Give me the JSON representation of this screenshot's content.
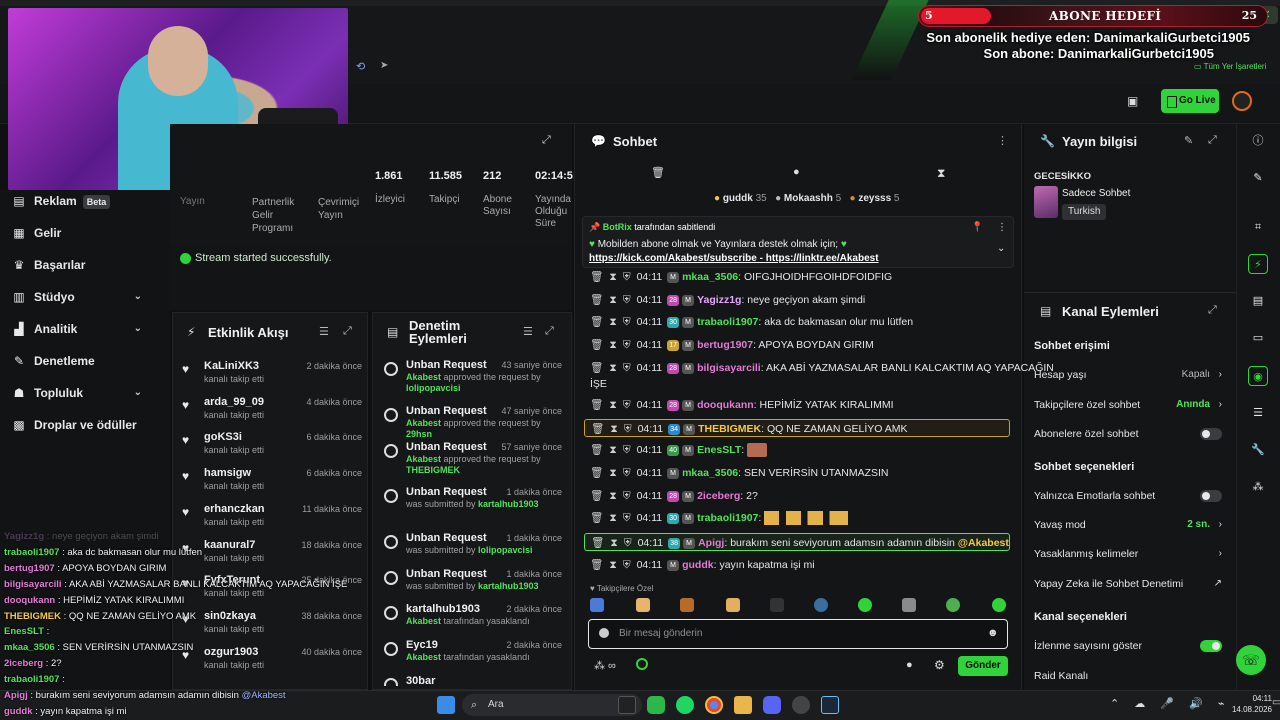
{
  "overlay": {
    "subgoal_current": "5",
    "subgoal_label": "ABONE HEDEFİ",
    "subgoal_target": "25",
    "gift_line": "Son abonelik hediye eden: DanimarkaliGurbetci1905",
    "last_sub_line": "Son abone: DanimarkaliGurbetci1905",
    "bookmarks": "Tüm Yer İşaretleri"
  },
  "header": {
    "go_live": "Go Live"
  },
  "sidebar": {
    "items": [
      {
        "label": "Reklam",
        "badge": "Beta"
      },
      {
        "label": "Gelir"
      },
      {
        "label": "Başarılar"
      },
      {
        "label": "Stüdyo"
      },
      {
        "label": "Analitik"
      },
      {
        "label": "Denetleme"
      },
      {
        "label": "Topluluk"
      },
      {
        "label": "Droplar ve ödüller"
      }
    ]
  },
  "stats": {
    "partial": {
      "label1": "Yayın",
      "label2": "Partnerlik Gelir Programı",
      "label3": "Çevrimiçi Yayın"
    },
    "viewers": {
      "value": "1.861",
      "label": "İzleyici"
    },
    "followers": {
      "value": "11.585",
      "label": "Takipçi"
    },
    "subs": {
      "value": "212",
      "label": "Abone Sayısı"
    },
    "uptime": {
      "value": "02:14:5:",
      "label": "Yayında Olduğu Süre"
    }
  },
  "toast": "Stream started successfully.",
  "activity": {
    "title": "Etkinlik Akışı",
    "items": [
      {
        "name": "KaLiniXK3",
        "sub": "kanalı takip etti",
        "time": "2 dakika önce"
      },
      {
        "name": "arda_99_09",
        "sub": "kanalı takip etti",
        "time": "4 dakika önce"
      },
      {
        "name": "goKS3i",
        "sub": "kanalı takip etti",
        "time": "6 dakika önce"
      },
      {
        "name": "hamsigw",
        "sub": "kanalı takip etti",
        "time": "6 dakika önce"
      },
      {
        "name": "erhanczkan",
        "sub": "kanalı takip etti",
        "time": "11 dakika önce"
      },
      {
        "name": "kaanural7",
        "sub": "kanalı takip etti",
        "time": "18 dakika önce"
      },
      {
        "name": "FyfxTerunt",
        "sub": "kanalı takip etti",
        "time": "25 dakika önce"
      },
      {
        "name": "sin0zkaya",
        "sub": "kanalı takip etti",
        "time": "38 dakika önce"
      },
      {
        "name": "ozgur1903",
        "sub": "kanalı takip etti",
        "time": "40 dakika önce"
      }
    ]
  },
  "moderation": {
    "title": "Denetim Eylemleri",
    "items": [
      {
        "name": "Unban Request",
        "who": "Akabest",
        "sub": " approved the request by ",
        "target": "lolipopavcisi",
        "time": "43 saniye önce"
      },
      {
        "name": "Unban Request",
        "who": "Akabest",
        "sub": " approved the request by ",
        "target": "29hsn",
        "time": "47 saniye önce"
      },
      {
        "name": "Unban Request",
        "who": "Akabest",
        "sub": " approved the request by ",
        "target": "THEBIGMEK",
        "time": "57 saniye önce"
      },
      {
        "name": "Unban Request",
        "who": "",
        "sub": "was submitted by ",
        "target": "kartalhub1903",
        "time": "1 dakika önce"
      },
      {
        "name": "Unban Request",
        "who": "",
        "sub": "was submitted by ",
        "target": "lolipopavcisi",
        "time": "1 dakika önce"
      },
      {
        "name": "Unban Request",
        "who": "",
        "sub": "was submitted by ",
        "target": "kartalhub1903",
        "time": "1 dakika önce"
      },
      {
        "name": "kartalhub1903",
        "who": "Akabest",
        "sub": " tarafından yasaklandı",
        "target": "",
        "time": "2 dakika önce"
      },
      {
        "name": "Eyc19",
        "who": "Akabest",
        "sub": " tarafından yasaklandı",
        "target": "",
        "time": "2 dakika önce"
      },
      {
        "name": "30bar",
        "who": "",
        "sub": "",
        "target": "",
        "time": ""
      }
    ]
  },
  "chat": {
    "title": "Sohbet",
    "top_gifters": [
      {
        "name": "guddk",
        "count": "35"
      },
      {
        "name": "Mokaashh",
        "count": "5"
      },
      {
        "name": "zeysss",
        "count": "5"
      }
    ],
    "pinned": {
      "by": "BotRix",
      "by_suffix": "tarafından sabitlendi",
      "text": "Mobilden abone olmak ve Yayınlara destek olmak için;",
      "link1": "https://kick.com/Akabest/subscribe",
      "sep": " - ",
      "link2": "https://linktr.ee/Akabest"
    },
    "messages": [
      {
        "time": "04:11",
        "badge": "",
        "user": "mkaa_3506",
        "color": "#53e05c",
        "text": "OIFGJHOIDHFGOIHDFOIDFIG"
      },
      {
        "time": "04:11",
        "badge": "28",
        "user": "Yagizz1g",
        "color": "#e6a6ff",
        "text": "neye geçiyon akam şimdi"
      },
      {
        "time": "04:11",
        "badge": "30",
        "user": "trabaoli1907",
        "color": "#53e05c",
        "text": "aka dc bakmasan olur mu lütfen"
      },
      {
        "time": "04:11",
        "badge": "17",
        "user": "bertug1907",
        "color": "#e37bd6",
        "text": "APOYA BOYDAN GIRIM"
      },
      {
        "time": "04:11",
        "badge": "28",
        "user": "bilgisayarcili",
        "color": "#e37bd6",
        "text": "AKA ABİ YAZMASALAR BANLI KALCAKTIM AQ YAPACAĞIN"
      },
      {
        "time": "",
        "badge": "",
        "user": "",
        "color": "#e6e6e6",
        "text": "İŞE"
      },
      {
        "time": "04:11",
        "badge": "28",
        "user": "dooqukann",
        "color": "#e37bd6",
        "text": "HEPİMİZ YATAK KIRALIMMI"
      },
      {
        "time": "04:11",
        "badge": "34",
        "user": "THEBIGMEK",
        "color": "#f2c94c",
        "text": "QQ NE ZAMAN GELİYO AMK"
      },
      {
        "time": "04:11",
        "badge": "40",
        "user": "EnesSLT",
        "color": "#53e05c",
        "text": ""
      },
      {
        "time": "04:11",
        "badge": "",
        "user": "mkaa_3506",
        "color": "#53e05c",
        "text": "SEN VERİRSİN UTANMAZSIN"
      },
      {
        "time": "04:11",
        "badge": "28",
        "user": "2iceberg",
        "color": "#e37bd6",
        "text": "2?"
      },
      {
        "time": "04:11",
        "badge": "30",
        "user": "trabaoli1907",
        "color": "#53e05c",
        "text": ""
      },
      {
        "time": "04:11",
        "badge": "38",
        "user": "Apigj",
        "color": "#e37bd6",
        "text": "burakım seni seviyorum adamsın adamın dibisin ",
        "mention": "@Akabest"
      },
      {
        "time": "04:11",
        "badge": "",
        "user": "guddk",
        "color": "#e37bd6",
        "text": "yayın kapatma işi mi"
      }
    ],
    "emote_label": "Takipçilere Özel",
    "input_placeholder": "Bir mesaj gönderin",
    "send": "Gönder"
  },
  "stream_info": {
    "title": "Yayın bilgisi",
    "category": "GECESİKKO",
    "stream_title": "Sadece Sohbet",
    "language": "Turkish"
  },
  "channel_actions": {
    "title": "Kanal Eylemleri",
    "sections": [
      {
        "heading": "Sohbet erişimi"
      },
      {
        "label": "Hesap yaşı",
        "value": "Kapalı",
        "type": "chev"
      },
      {
        "label": "Takipçilere özel sohbet",
        "value": "Anında",
        "type": "chev",
        "green": true
      },
      {
        "label": "Abonelere özel sohbet",
        "type": "toggle",
        "on": false
      },
      {
        "heading": "Sohbet seçenekleri"
      },
      {
        "label": "Yalnızca Emotlarla sohbet",
        "type": "toggle",
        "on": false
      },
      {
        "label": "Yavaş mod",
        "value": "2 sn.",
        "type": "chev",
        "green": true
      },
      {
        "label": "Yasaklanmış kelimeler",
        "type": "chev"
      },
      {
        "label": "Yapay Zeka ile Sohbet Denetimi",
        "type": "ext"
      },
      {
        "heading": "Kanal seçenekleri"
      },
      {
        "label": "İzlenme sayısını göster",
        "type": "toggle",
        "on": true
      },
      {
        "label": "Raid Kanalı",
        "type": "none"
      }
    ]
  },
  "overlay_chat": [
    {
      "user": "Yagizz1g",
      "color": "#e6a6ff",
      "text": " : neye geçiyon akam şimdi",
      "faded": true
    },
    {
      "user": "trabaoli1907",
      "color": "#53e05c",
      "text": " : aka dc bakmasan olur mu lütfen"
    },
    {
      "user": "bertug1907",
      "color": "#e37bd6",
      "text": " : APOYA BOYDAN GIRIM"
    },
    {
      "user": "bilgisayarcili",
      "color": "#e37bd6",
      "text": " : AKA ABİ YAZMASALAR BANLI KALCAKTIM AQ YAPACAĞIN İŞE"
    },
    {
      "user": "dooqukann",
      "color": "#e37bd6",
      "text": " : HEPİMİZ YATAK KIRALIMMI"
    },
    {
      "user": "THEBIGMEK",
      "color": "#f2c94c",
      "text": " : QQ NE ZAMAN GELİYO AMK"
    },
    {
      "user": "EnesSLT",
      "color": "#53e05c",
      "text": " :"
    },
    {
      "user": "mkaa_3506",
      "color": "#53e05c",
      "text": " : SEN VERİRSİN UTANMAZSIN"
    },
    {
      "user": "2iceberg",
      "color": "#e37bd6",
      "text": " : 2?"
    },
    {
      "user": "trabaoli1907",
      "color": "#53e05c",
      "text": " :"
    },
    {
      "user": "Apigj",
      "color": "#e37bd6",
      "text": " : burakım seni seviyorum adamsın adamın dibisin ",
      "mention": "@Akabest"
    },
    {
      "user": "guddk",
      "color": "#e37bd6",
      "text": " : yayın kapatma işi mi"
    }
  ],
  "taskbar": {
    "search": "Ara",
    "time": "04:11",
    "date": "14.08.2026"
  }
}
